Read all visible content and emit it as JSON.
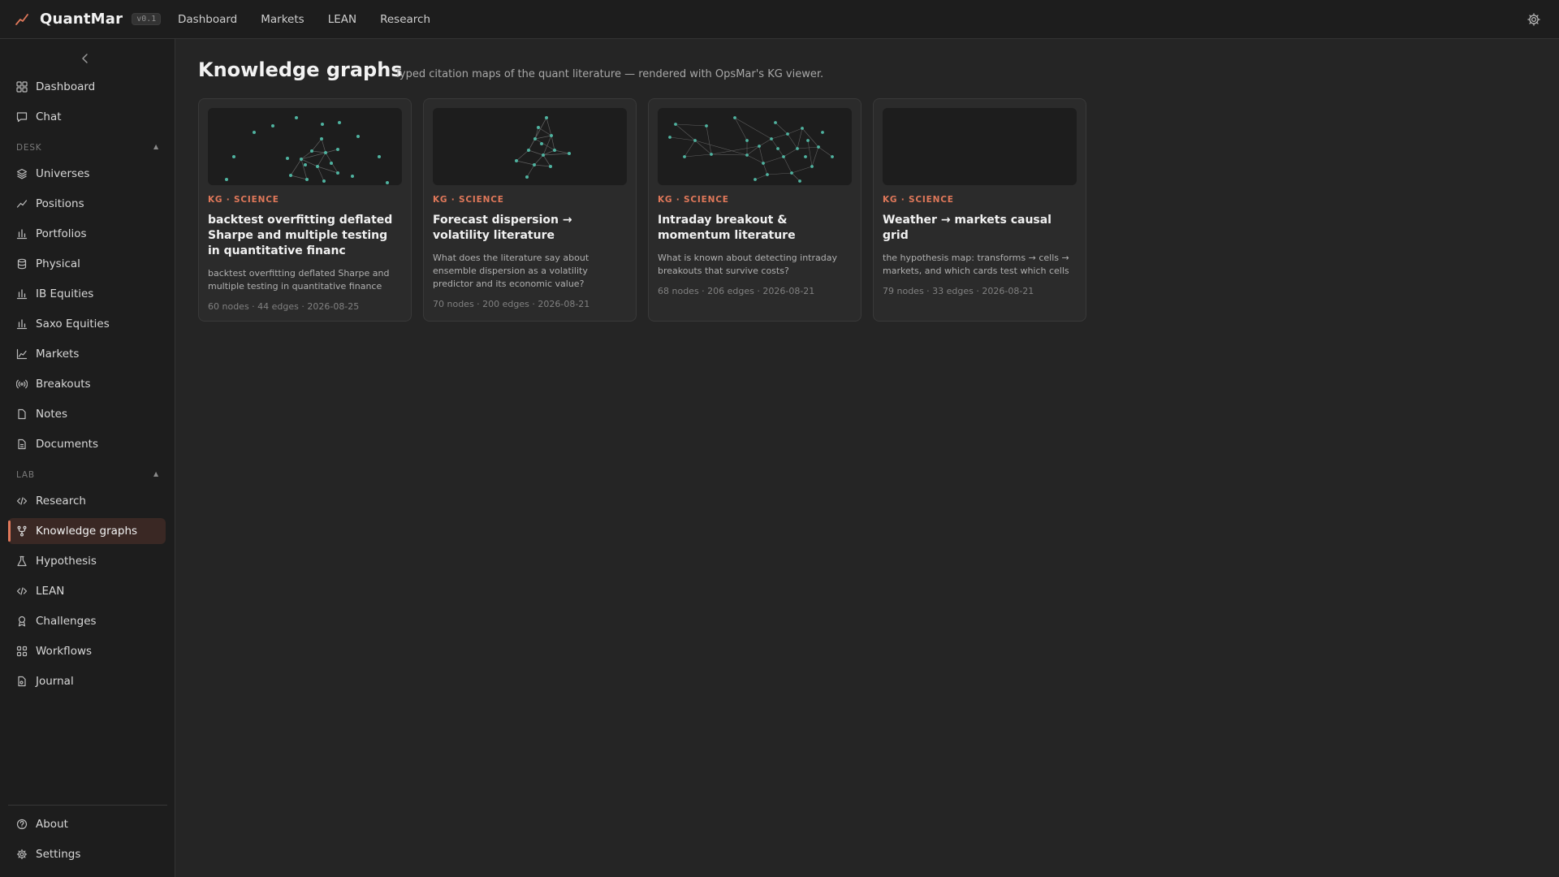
{
  "app": {
    "name": "QuantMar",
    "version": "v0.1"
  },
  "topnav": [
    "Dashboard",
    "Markets",
    "LEAN",
    "Research"
  ],
  "sidebar": {
    "top_items": [
      "Dashboard",
      "Chat"
    ],
    "desk_label": "DESK",
    "desk_items": [
      "Universes",
      "Positions",
      "Portfolios",
      "Physical",
      "IB Equities",
      "Saxo Equities",
      "Markets",
      "Breakouts",
      "Notes",
      "Documents"
    ],
    "lab_label": "LAB",
    "lab_items": [
      "Research",
      "Knowledge graphs",
      "Hypothesis",
      "LEAN",
      "Challenges",
      "Workflows",
      "Journal"
    ],
    "active_item": "Knowledge graphs",
    "bottom_items": [
      "About",
      "Settings"
    ]
  },
  "page": {
    "title": "Knowledge graphs",
    "subtitle": "Typed citation maps of the quant literature — rendered with OpsMar's KG viewer."
  },
  "cards": [
    {
      "tag": "KG · SCIENCE",
      "title": "backtest overfitting deflated Sharpe and multiple testing in quantitative financ",
      "desc": "backtest overfitting deflated Sharpe and multiple testing in quantitative finance",
      "meta": "60 nodes · 44 edges · 2026-08-25"
    },
    {
      "tag": "KG · SCIENCE",
      "title": "Forecast dispersion → volatility literature",
      "desc": "What does the literature say about ensemble dispersion as a volatility predictor and its economic value?",
      "meta": "70 nodes · 200 edges · 2026-08-21"
    },
    {
      "tag": "KG · SCIENCE",
      "title": "Intraday breakout & momentum literature",
      "desc": "What is known about detecting intraday breakouts that survive costs?",
      "meta": "68 nodes · 206 edges · 2026-08-21"
    },
    {
      "tag": "KG · SCIENCE",
      "title": "Weather → markets causal grid",
      "desc": "the hypothesis map: transforms → cells → markets, and which cards test which cells",
      "meta": "79 nodes · 33 edges · 2026-08-21"
    }
  ],
  "colors": {
    "accent": "#e0785a",
    "node": "#4fb3a0",
    "edge": "#6a6a6a"
  }
}
